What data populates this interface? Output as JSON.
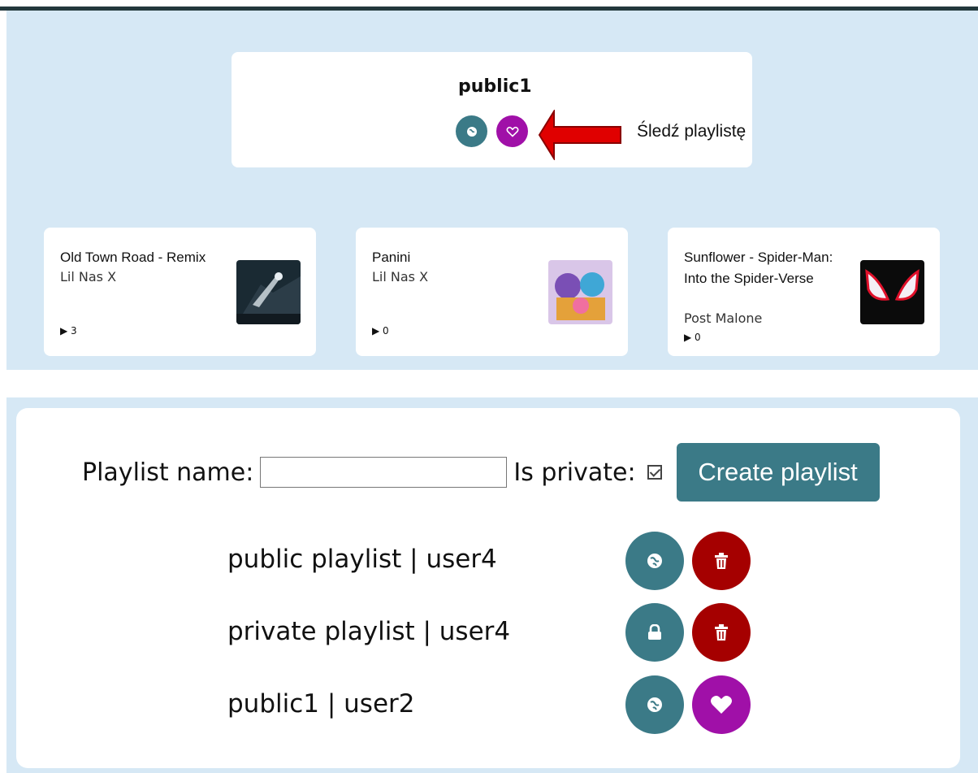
{
  "playlist_header": {
    "title": "public1",
    "note": "Śledź playlistę"
  },
  "songs": [
    {
      "title": "Old Town Road - Remix",
      "artist": "Lil Nas X",
      "plays": "3"
    },
    {
      "title": "Panini",
      "artist": "Lil Nas X",
      "plays": "0"
    },
    {
      "title": "Sunflower - Spider-Man: Into the Spider-Verse",
      "artist": "Post Malone",
      "plays": "0"
    }
  ],
  "create_form": {
    "name_label": "Playlist name:",
    "name_value": "",
    "private_label": "Is private:",
    "is_private": true,
    "button_label": "Create playlist"
  },
  "playlists": [
    {
      "label": "public playlist | user4",
      "visibility_icon": "globe-icon",
      "action_icon": "trash-icon"
    },
    {
      "label": "private playlist | user4",
      "visibility_icon": "lock-icon",
      "action_icon": "trash-icon"
    },
    {
      "label": "public1 | user2",
      "visibility_icon": "globe-icon",
      "action_icon": "heart-icon"
    }
  ],
  "colors": {
    "background": "#d6e8f5",
    "teal": "#3b7a87",
    "purple": "#a010a8",
    "red": "#a50000",
    "arrow": "#e00000"
  }
}
